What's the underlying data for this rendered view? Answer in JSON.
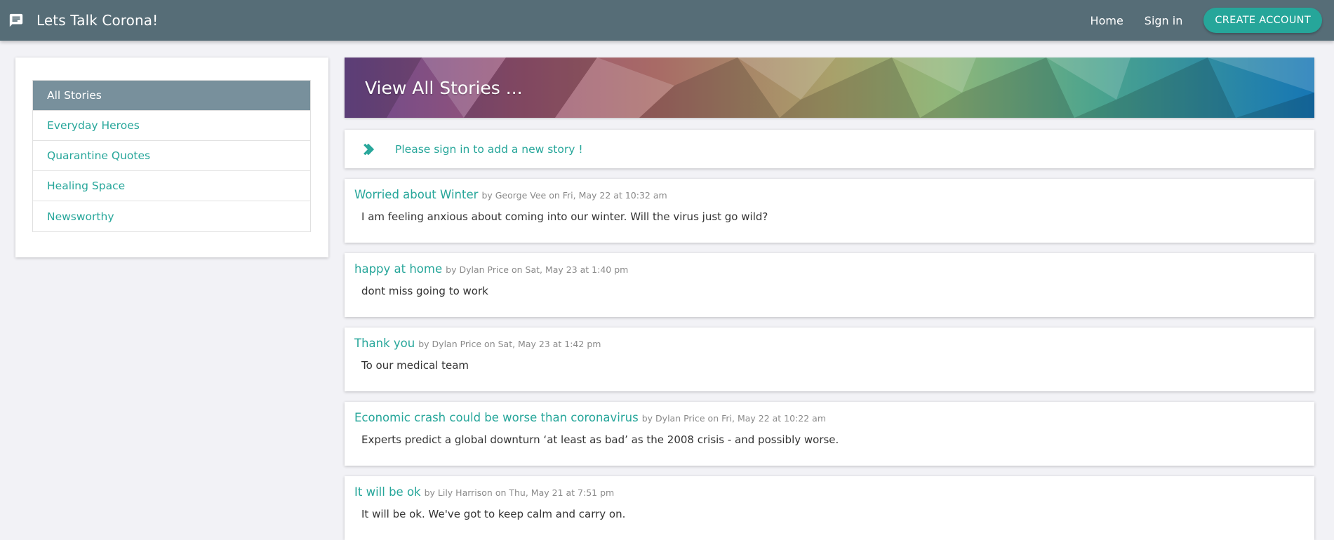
{
  "app": {
    "title": "Lets Talk Corona!",
    "brand_icon": "chat-bubble-icon"
  },
  "nav": {
    "home": "Home",
    "signin": "Sign in",
    "create_account": "CREATE ACCOUNT"
  },
  "sidebar": {
    "items": [
      {
        "label": "All Stories",
        "active": true
      },
      {
        "label": "Everyday Heroes",
        "active": false
      },
      {
        "label": "Quarantine Quotes",
        "active": false
      },
      {
        "label": "Healing Space",
        "active": false
      },
      {
        "label": "Newsworthy",
        "active": false
      }
    ]
  },
  "banner": {
    "title": "View All Stories ..."
  },
  "notice": {
    "icon": "double-chevron-right-icon",
    "text": "Please sign in to add a new story !"
  },
  "stories": [
    {
      "title": "Worried about Winter",
      "meta": "by George Vee on Fri, May 22 at 10:32 am",
      "body": "I am feeling anxious about coming into our winter. Will the virus just go wild?"
    },
    {
      "title": "happy at home",
      "meta": "by Dylan Price on Sat, May 23 at 1:40 pm",
      "body": "dont miss going to work"
    },
    {
      "title": "Thank you",
      "meta": "by Dylan Price on Sat, May 23 at 1:42 pm",
      "body": "To our medical team"
    },
    {
      "title": "Economic crash could be worse than coronavirus",
      "meta": "by Dylan Price on Fri, May 22 at 10:22 am",
      "body": "Experts predict a global downturn ‘at least as bad’ as the 2008 crisis - and possibly worse."
    },
    {
      "title": "It will be ok",
      "meta": "by Lily Harrison on Thu, May 21 at 7:51 pm",
      "body": "It will be ok. We've got to keep calm and carry on."
    }
  ],
  "colors": {
    "topbar": "#566d77",
    "accent": "#26a69a",
    "active_item": "#78909c",
    "background": "#f2f2f6"
  }
}
